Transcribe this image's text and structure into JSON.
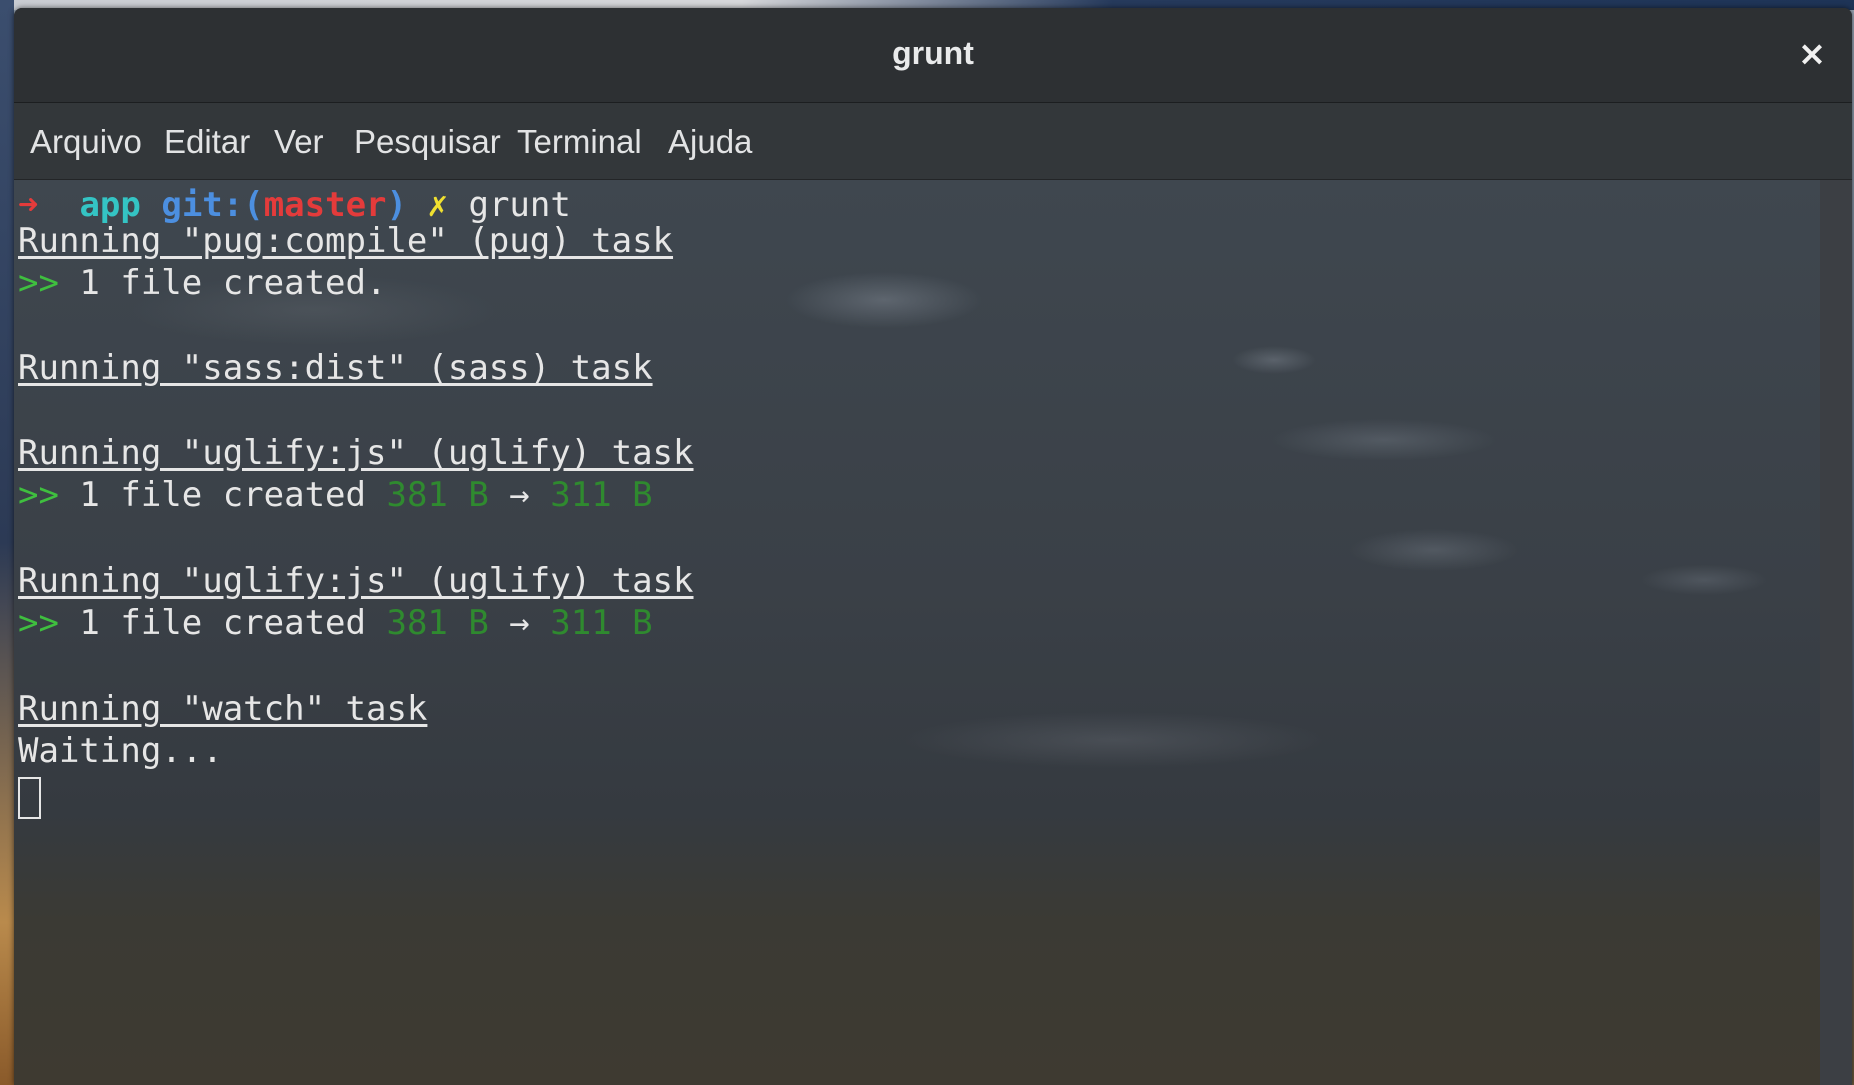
{
  "window": {
    "title": "grunt",
    "close_label": "×"
  },
  "menu": [
    "Arquivo",
    "Editar",
    "Ver",
    "Pesquisar",
    "Terminal",
    "Ajuda"
  ],
  "prompt": {
    "arrow": "➜",
    "dir": "app",
    "git_prefix": "git:(",
    "branch": "master",
    "git_suffix": ")",
    "dirty_mark": "✗",
    "command": "grunt"
  },
  "output": {
    "pug_task": "Running \"pug:compile\" (pug) task",
    "pug_marker": ">>",
    "pug_result": " 1 file created.",
    "sass_task": "Running \"sass:dist\" (sass) task",
    "uglify_task_1": "Running \"uglify:js\" (uglify) task",
    "uglify_marker_1": ">>",
    "uglify_result_1": " 1 file created ",
    "uglify_from_1": "381 B",
    "uglify_arrow_1": " → ",
    "uglify_to_1": "311 B",
    "uglify_task_2": "Running \"uglify:js\" (uglify) task",
    "uglify_marker_2": ">>",
    "uglify_result_2": " 1 file created ",
    "uglify_from_2": "381 B",
    "uglify_arrow_2": " → ",
    "uglify_to_2": "311 B",
    "watch_task": "Running \"watch\" task",
    "waiting": "Waiting..."
  },
  "colors": {
    "prompt_arrow": "#e43b3b",
    "dir": "#34c4c4",
    "git": "#4c8fe0",
    "branch": "#e43b3b",
    "dirty": "#f0e030",
    "success_marker": "#3fbf3f",
    "size_text": "#2f8a2f"
  }
}
